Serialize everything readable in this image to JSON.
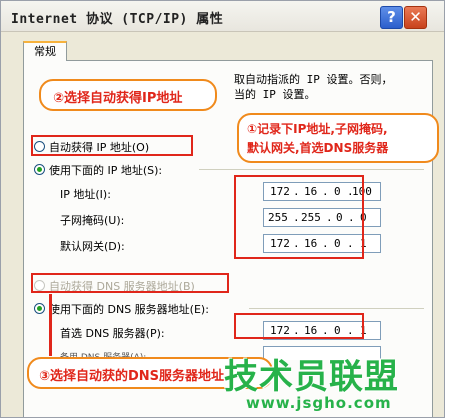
{
  "window": {
    "title": "Internet 协议 (TCP/IP) 属性",
    "help_label": "?",
    "close_label": "✕"
  },
  "tabs": [
    {
      "label": "常规"
    }
  ],
  "intro": {
    "line1_tail": "取自动指派的 IP 设置。否则，",
    "line2_tail": "当的 IP 设置。"
  },
  "ip_section": {
    "auto_label": "自动获得 IP 地址(O)",
    "manual_label": "使用下面的 IP 地址(S):",
    "manual_selected": true,
    "fields": [
      {
        "label": "IP 地址(I):",
        "octets": [
          "172",
          "16",
          "0",
          "100"
        ]
      },
      {
        "label": "子网掩码(U):",
        "octets": [
          "255",
          "255",
          "0",
          "0"
        ]
      },
      {
        "label": "默认网关(D):",
        "octets": [
          "172",
          "16",
          "0",
          "1"
        ]
      }
    ]
  },
  "dns_section": {
    "auto_label": "自动获得 DNS 服务器地址(B)",
    "manual_label": "使用下面的 DNS 服务器地址(E):",
    "manual_selected": true,
    "preferred_label": "首选 DNS 服务器(P):",
    "preferred_octets": [
      "172",
      "16",
      "0",
      "1"
    ],
    "alternate_label_partial": "备用 DNS 服务器(A):"
  },
  "annotations": {
    "callout_top": "②选择自动获得IP地址",
    "callout_right_line1": "①记录下IP地址,子网掩码,",
    "callout_right_line2": "默认网关,首选DNS服务器",
    "callout_bottom": "③选择自动获的DNS服务器地址",
    "annotation_color": "#e0261a",
    "callout_border_color": "#f08a1c"
  },
  "watermark": {
    "brand": "技术员联盟",
    "url": "www.jsgho.com",
    "color": "#27b24a"
  }
}
